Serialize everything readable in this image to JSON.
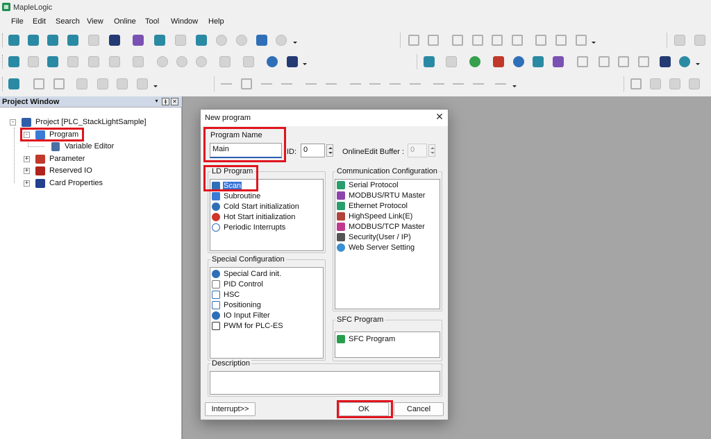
{
  "app": {
    "title": "MapleLogic",
    "icon": "maplelogic-app-icon"
  },
  "menu": [
    "File",
    "Edit",
    "Search",
    "View",
    "Online",
    "Tool",
    "Window",
    "Help"
  ],
  "toolbar": {
    "row1_icons": [
      "new-project-icon",
      "open-project-icon",
      "save-as-icon",
      "import-icon",
      "save-icon",
      "save-all-icon",
      "grid-icon",
      "new-program-icon",
      "close-program-icon",
      "program-icon",
      "disabled-circle-icon",
      "disabled-circle-icon",
      "print-icon",
      "help-icon",
      "undo-icon",
      "redo-icon",
      "find-icon",
      "copy-icon",
      "paste-icon",
      "edit-icon",
      "list-icon",
      "list-icon",
      "list-icon",
      "monitor-icon",
      "monitor-icon"
    ],
    "row2_icons": [
      "transfer-icon",
      "compare-icon",
      "download-icon",
      "upload-icon",
      "verify-icon",
      "transfer-icon",
      "monitor-icon",
      "link-icon",
      "link-icon",
      "link-icon",
      "lock-icon",
      "info-icon",
      "globe-icon",
      "scope-icon",
      "plc-icon",
      "plc-icon",
      "switch-icon",
      "error-icon",
      "settings-icon",
      "calculator-icon",
      "trend-icon",
      "document-icon",
      "document-icon",
      "document-icon",
      "document-icon",
      "tools-icon",
      "run-icon"
    ],
    "row3_icons": [
      "simulator-icon",
      "zoom-in-icon",
      "zoom-out-icon",
      "table-icon",
      "table-icon",
      "table-icon",
      "table-icon",
      "contact-esc-icon",
      "edit-icon",
      "f2-icon",
      "f3-icon",
      "f2-key-icon",
      "f4-key-icon",
      "f5-key-icon",
      "f6-key-icon",
      "f7-key-icon",
      "f8-key-icon",
      "f9-key-icon",
      "f10-key-icon",
      "f12-key-icon",
      "sf9-key-icon",
      "play-icon",
      "step-icon",
      "hammer-icon",
      "check-icon"
    ]
  },
  "project_window": {
    "title": "Project Window",
    "tree": [
      {
        "label": "Project [PLC_StackLightSample]",
        "icon": "project-icon"
      },
      {
        "label": "Program",
        "icon": "program-folder-icon"
      },
      {
        "label": "Variable Editor",
        "icon": "variable-editor-icon"
      },
      {
        "label": "Parameter",
        "icon": "parameter-icon"
      },
      {
        "label": "Reserved IO",
        "icon": "reserved-io-icon"
      },
      {
        "label": "Card Properties",
        "icon": "card-properties-icon"
      }
    ]
  },
  "dialog": {
    "title": "New program",
    "program_name_label": "Program Name",
    "program_name_value": "Main",
    "id_label": "ID:",
    "id_value": "0",
    "online_edit_label": "OnlineEdit Buffer :",
    "online_edit_value": "0",
    "ld_program": {
      "caption": "LD Program",
      "items": [
        {
          "label": "Scan",
          "icon": "scan-icon",
          "selected": true
        },
        {
          "label": "Subroutine",
          "icon": "subroutine-icon"
        },
        {
          "label": "Cold Start initialization",
          "icon": "cold-start-icon"
        },
        {
          "label": "Hot Start initialization",
          "icon": "hot-start-icon"
        },
        {
          "label": "Periodic Interrupts",
          "icon": "clock-icon"
        }
      ]
    },
    "communication": {
      "caption": "Communication Configuration",
      "items": [
        {
          "label": "Serial Protocol",
          "icon": "serial-protocol-icon"
        },
        {
          "label": "MODBUS/RTU Master",
          "icon": "modbus-rtu-icon"
        },
        {
          "label": "Ethernet Protocol",
          "icon": "ethernet-icon"
        },
        {
          "label": "HighSpeed Link(E)",
          "icon": "highspeed-link-icon"
        },
        {
          "label": "MODBUS/TCP Master",
          "icon": "modbus-tcp-icon"
        },
        {
          "label": "Security(User / IP)",
          "icon": "security-icon"
        },
        {
          "label": "Web Server Setting",
          "icon": "web-server-icon"
        }
      ]
    },
    "special": {
      "caption": "Special Configuration",
      "items": [
        {
          "label": "Special Card init.",
          "icon": "special-card-icon"
        },
        {
          "label": "PID Control",
          "icon": "pid-icon"
        },
        {
          "label": "HSC",
          "icon": "hsc-icon"
        },
        {
          "label": "Positioning",
          "icon": "positioning-icon"
        },
        {
          "label": "IO Input Filter",
          "icon": "io-filter-icon"
        },
        {
          "label": "PWM for PLC-ES",
          "icon": "pwm-icon"
        }
      ]
    },
    "sfc": {
      "caption": "SFC Program",
      "items": [
        {
          "label": "SFC Program",
          "icon": "sfc-icon"
        }
      ]
    },
    "description_caption": "Description",
    "interrupt_button": "Interrupt>>",
    "ok_button": "OK",
    "cancel_button": "Cancel"
  },
  "colors": {
    "highlight": "#e0141e",
    "selection": "#3875d7",
    "workspace": "#a5a5a5"
  }
}
